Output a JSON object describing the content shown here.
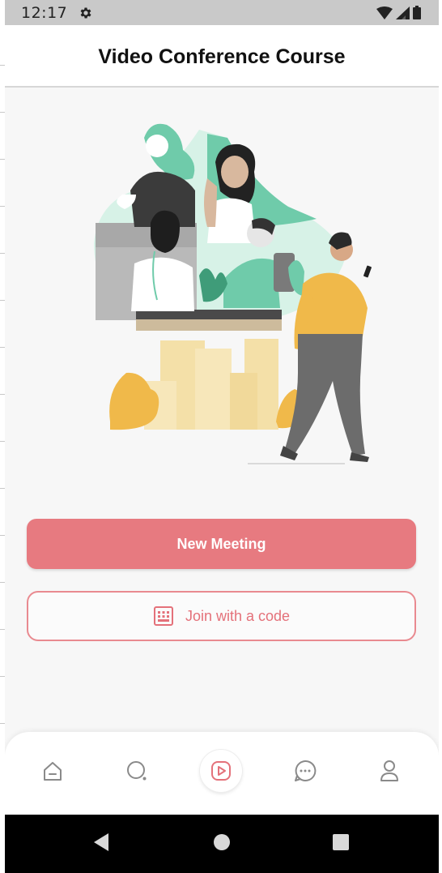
{
  "status_bar": {
    "time": "12:17",
    "icons": [
      "settings-gear-icon",
      "wifi-icon",
      "signal-icon",
      "battery-icon"
    ]
  },
  "app_bar": {
    "title": "Video Conference Course"
  },
  "illustration": {
    "description_icon": "video-conference-illustration-icon"
  },
  "actions": {
    "new_meeting_label": "New Meeting",
    "join_label": "Join with a code",
    "join_icon": "keypad-icon"
  },
  "bottom_nav": {
    "items": [
      {
        "icon": "home-icon",
        "active": false
      },
      {
        "icon": "search-icon",
        "active": false
      },
      {
        "icon": "video-play-icon",
        "active": true
      },
      {
        "icon": "chat-icon",
        "active": false
      },
      {
        "icon": "profile-icon",
        "active": false
      }
    ]
  },
  "system_nav": {
    "icons": [
      "back-icon",
      "home-circle-icon",
      "recents-icon"
    ]
  },
  "colors": {
    "accent": "#e77a80",
    "accent_text": "#e4717a",
    "status_bar_bg": "#c9c9c9",
    "system_nav_bg": "#000000",
    "illustration_green": "#6fcbaa",
    "illustration_yellow": "#f0b94a"
  }
}
